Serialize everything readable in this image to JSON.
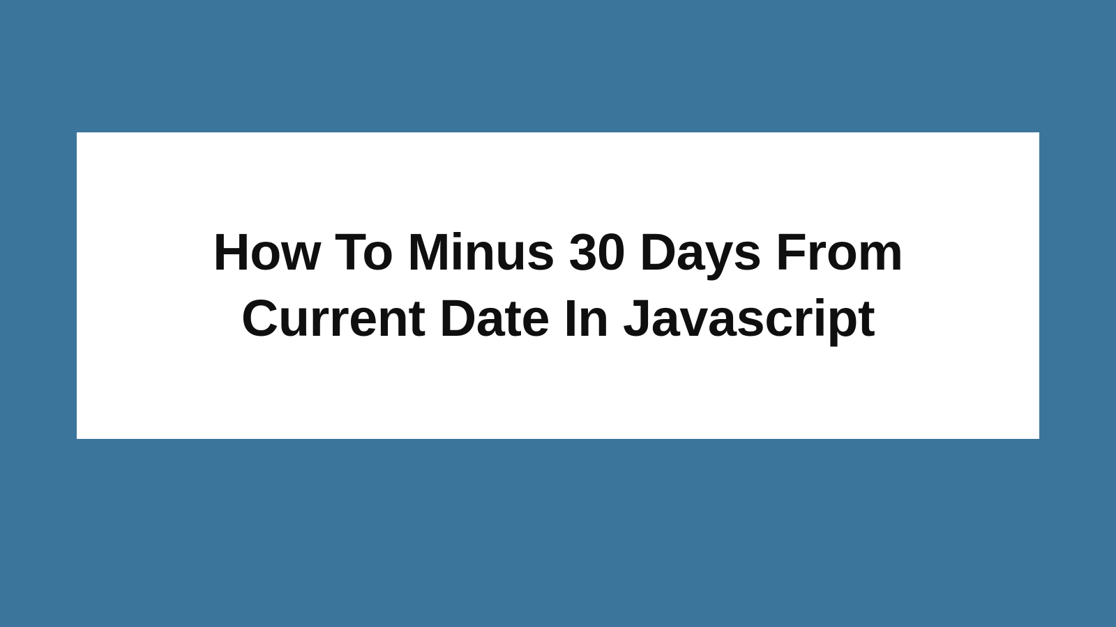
{
  "card": {
    "title": "How To Minus 30 Days From Current Date In Javascript"
  },
  "colors": {
    "background": "#3c759c",
    "cardBackground": "#ffffff",
    "text": "#0f0f0f"
  }
}
